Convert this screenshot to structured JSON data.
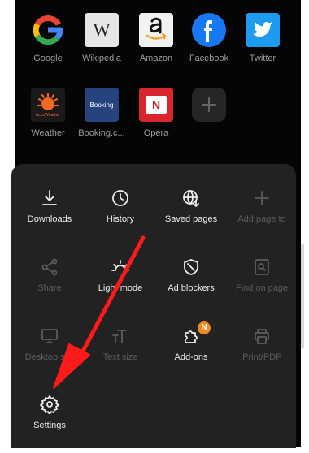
{
  "shortcuts": [
    {
      "label": "Google",
      "icon": "google-icon"
    },
    {
      "label": "Wikipedia",
      "icon": "wikipedia-icon"
    },
    {
      "label": "Amazon",
      "icon": "amazon-icon"
    },
    {
      "label": "Facebook",
      "icon": "facebook-icon"
    },
    {
      "label": "Twitter",
      "icon": "twitter-icon"
    },
    {
      "label": "Weather",
      "icon": "accuweather-icon"
    },
    {
      "label": "Booking.c...",
      "icon": "booking-icon"
    },
    {
      "label": "Opera",
      "icon": "opera-news-icon"
    },
    {
      "label": "",
      "icon": "add-shortcut-icon"
    }
  ],
  "menu": {
    "items": [
      {
        "label": "Downloads",
        "enabled": true
      },
      {
        "label": "History",
        "enabled": true
      },
      {
        "label": "Saved pages",
        "enabled": true
      },
      {
        "label": "Add page to",
        "enabled": false
      },
      {
        "label": "Share",
        "enabled": false
      },
      {
        "label": "Light mode",
        "enabled": true
      },
      {
        "label": "Ad blockers",
        "enabled": true
      },
      {
        "label": "Find on page",
        "enabled": false
      },
      {
        "label": "Desktop site",
        "enabled": false
      },
      {
        "label": "Text size",
        "enabled": false
      },
      {
        "label": "Add-ons",
        "enabled": true,
        "badge": "N"
      },
      {
        "label": "Print/PDF",
        "enabled": false
      },
      {
        "label": "Settings",
        "enabled": true
      }
    ]
  },
  "logo_text": {
    "wikipedia": "W",
    "booking": "Booking",
    "accuweather": "AccuWeather",
    "opera": "N"
  },
  "colors": {
    "annotation_arrow": "#ff1a1a",
    "badge": "#f08a24",
    "menu_bg": "#222222"
  }
}
